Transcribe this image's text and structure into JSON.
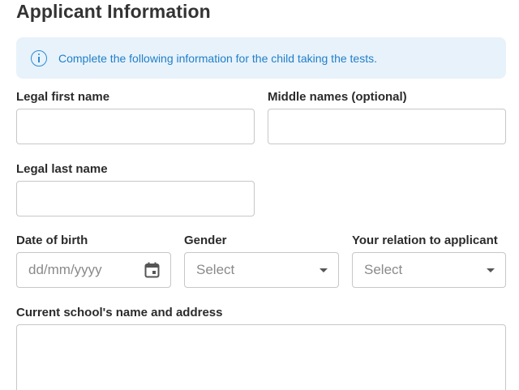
{
  "page_title": "Applicant Information",
  "info_banner": {
    "icon": "info-icon",
    "text": "Complete the following information for the child taking the tests."
  },
  "fields": {
    "first_name": {
      "label": "Legal first name",
      "value": ""
    },
    "middle_names": {
      "label": "Middle names (optional)",
      "value": ""
    },
    "last_name": {
      "label": "Legal last name",
      "value": ""
    },
    "date_of_birth": {
      "label": "Date of birth",
      "placeholder": "dd/mm/yyyy",
      "icon": "calendar-icon"
    },
    "gender": {
      "label": "Gender",
      "selected": "Select",
      "icon": "chevron-down-icon"
    },
    "relation": {
      "label": "Your relation to applicant",
      "selected": "Select",
      "icon": "chevron-down-icon"
    },
    "school": {
      "label": "Current school's name and address",
      "value": ""
    }
  },
  "colors": {
    "banner_bg": "#e8f2fb",
    "accent": "#1f7fc7",
    "border": "#c7c7c7"
  }
}
